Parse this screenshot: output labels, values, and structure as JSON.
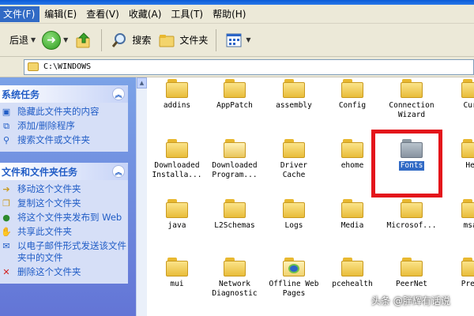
{
  "menubar": {
    "items": [
      {
        "label": "文件(F)"
      },
      {
        "label": "编辑(E)"
      },
      {
        "label": "查看(V)"
      },
      {
        "label": "收藏(A)"
      },
      {
        "label": "工具(T)"
      },
      {
        "label": "帮助(H)"
      }
    ]
  },
  "toolbar": {
    "back_label": "后退",
    "search_label": "搜索",
    "folders_label": "文件夹"
  },
  "address": {
    "path": "C:\\WINDOWS"
  },
  "taskpane": {
    "system": {
      "title": "系统任务",
      "links": [
        {
          "label": "隐藏此文件夹的内容"
        },
        {
          "label": "添加/删除程序"
        },
        {
          "label": "搜索文件或文件夹"
        }
      ]
    },
    "filefolder": {
      "title": "文件和文件夹任务",
      "links": [
        {
          "label": "移动这个文件夹"
        },
        {
          "label": "复制这个文件夹"
        },
        {
          "label": "将这个文件夹发布到 Web"
        },
        {
          "label": "共享此文件夹"
        },
        {
          "label": "以电子邮件形式发送该文件夹中的文件"
        },
        {
          "label": "删除这个文件夹"
        }
      ]
    }
  },
  "folders": [
    {
      "line1": "addins",
      "line2": ""
    },
    {
      "line1": "AppPatch",
      "line2": ""
    },
    {
      "line1": "assembly",
      "line2": ""
    },
    {
      "line1": "Config",
      "line2": ""
    },
    {
      "line1": "Connection",
      "line2": "Wizard"
    },
    {
      "line1": "Curs",
      "line2": ""
    },
    {
      "line1": "Downloaded",
      "line2": "Installa..."
    },
    {
      "line1": "Downloaded",
      "line2": "Program..."
    },
    {
      "line1": "Driver",
      "line2": "Cache"
    },
    {
      "line1": "ehome",
      "line2": ""
    },
    {
      "line1": "Fonts",
      "line2": ""
    },
    {
      "line1": "Hel",
      "line2": ""
    },
    {
      "line1": "java",
      "line2": ""
    },
    {
      "line1": "L2Schemas",
      "line2": ""
    },
    {
      "line1": "Logs",
      "line2": ""
    },
    {
      "line1": "Media",
      "line2": ""
    },
    {
      "line1": "Microsof...",
      "line2": ""
    },
    {
      "line1": "msag",
      "line2": ""
    },
    {
      "line1": "mui",
      "line2": ""
    },
    {
      "line1": "Network",
      "line2": "Diagnostic"
    },
    {
      "line1": "Offline Web",
      "line2": "Pages"
    },
    {
      "line1": "pcehealth",
      "line2": ""
    },
    {
      "line1": "PeerNet",
      "line2": ""
    },
    {
      "line1": "Prefe",
      "line2": ""
    }
  ],
  "watermark": "头条 @胖辉有话说"
}
